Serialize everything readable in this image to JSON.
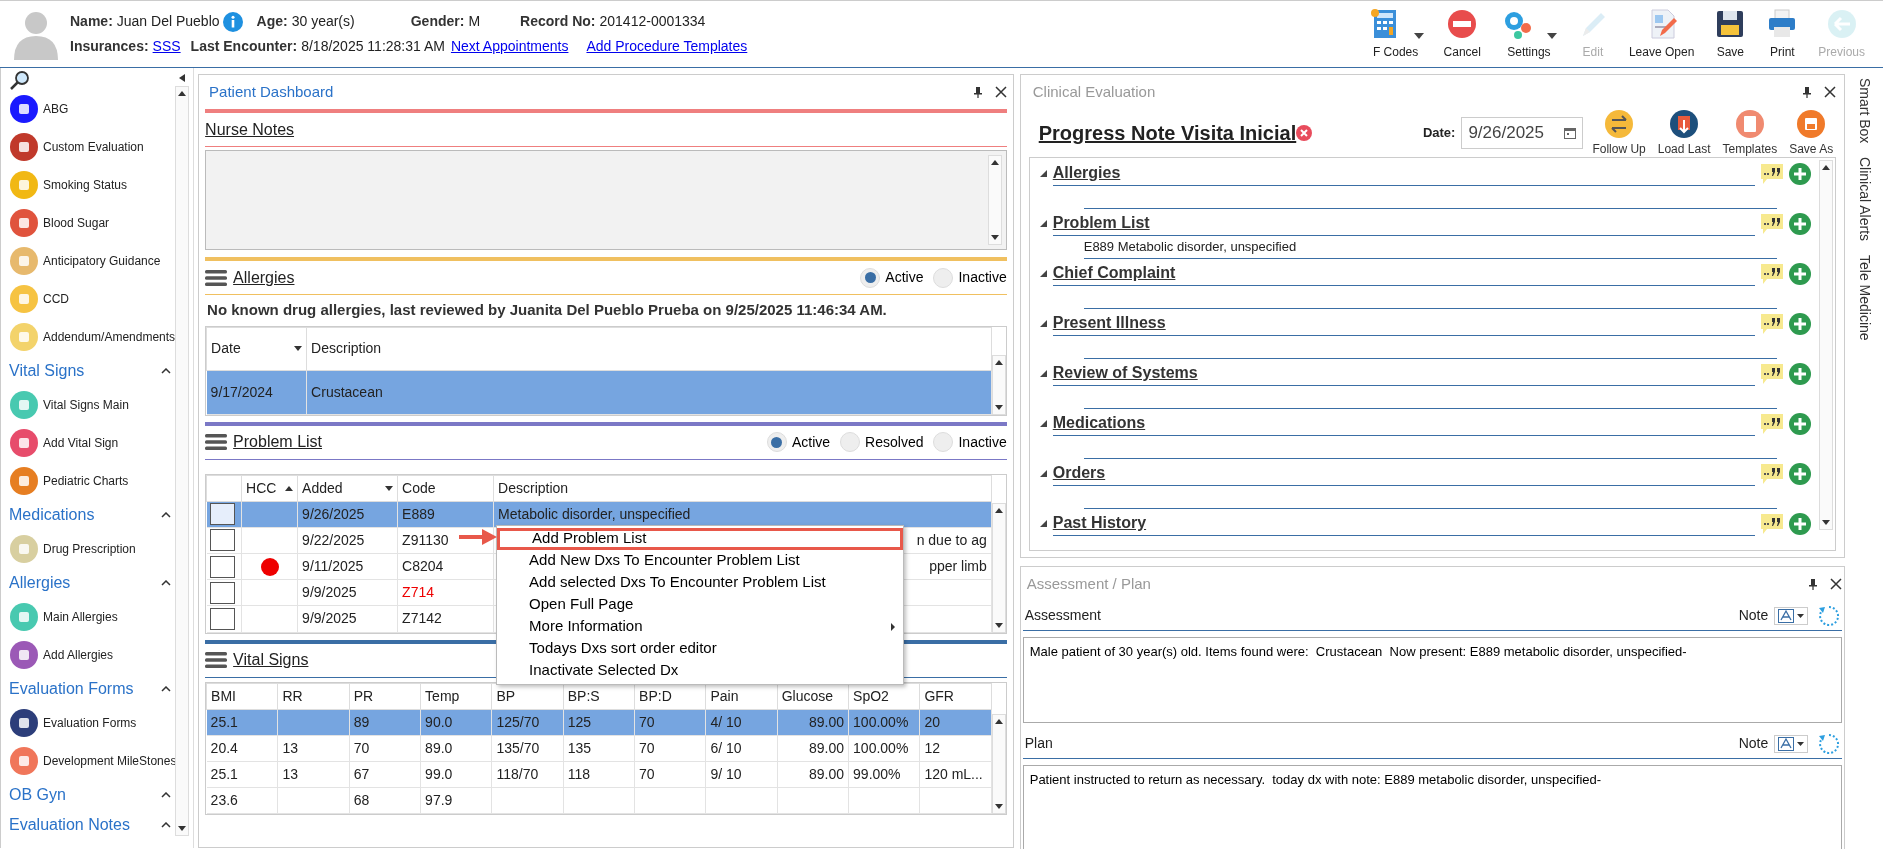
{
  "header": {
    "name_label": "Name:",
    "name": "Juan Del Pueblo",
    "age_label": "Age:",
    "age": "30 year(s)",
    "gender_label": "Gender:",
    "gender": "M",
    "record_label": "Record No:",
    "record": "201412-0001334",
    "insurances_label": "Insurances:",
    "insurance": "SSS",
    "last_encounter_label": "Last Encounter:",
    "last_encounter": "8/18/2025 11:28:31 AM",
    "links": [
      "Next Appointments",
      "Add Procedure Templates"
    ]
  },
  "toolbar": [
    {
      "label": "F Codes",
      "dropdown": true,
      "disabled": false
    },
    {
      "label": "Cancel",
      "dropdown": false,
      "disabled": false
    },
    {
      "label": "Settings",
      "dropdown": true,
      "disabled": false
    },
    {
      "label": "Edit",
      "dropdown": false,
      "disabled": true
    },
    {
      "label": "Leave Open",
      "dropdown": false,
      "disabled": false
    },
    {
      "label": "Save",
      "dropdown": false,
      "disabled": false
    },
    {
      "label": "Print",
      "dropdown": false,
      "disabled": false
    },
    {
      "label": "Previous",
      "dropdown": false,
      "disabled": true
    }
  ],
  "sidebar": {
    "items": [
      "ABG",
      "Custom Evaluation",
      "Smoking Status",
      "Blood Sugar",
      "Anticipatory Guidance",
      "CCD",
      "Addendum/Amendments"
    ],
    "sections": [
      {
        "title": "Vital Signs",
        "expanded": true,
        "items": [
          "Vital Signs Main",
          "Add Vital Sign",
          "Pediatric Charts"
        ]
      },
      {
        "title": "Medications",
        "expanded": true,
        "items": [
          "Drug Prescription"
        ]
      },
      {
        "title": "Allergies",
        "expanded": true,
        "items": [
          "Main Allergies",
          "Add Allergies"
        ]
      },
      {
        "title": "Evaluation Forms",
        "expanded": true,
        "items": [
          "Evaluation Forms",
          "Development MileStones"
        ]
      },
      {
        "title": "OB Gyn",
        "expanded": true
      },
      {
        "title": "Evaluation Notes",
        "expanded": true
      }
    ]
  },
  "dashboard": {
    "title": "Patient Dashboard",
    "nurse_notes": {
      "title": "Nurse Notes"
    },
    "allergies": {
      "title": "Allergies",
      "filters": [
        {
          "label": "Active",
          "selected": true
        },
        {
          "label": "Inactive",
          "selected": false
        }
      ],
      "note": "No known drug allergies, last reviewed by Juanita Del Pueblo Prueba on 9/25/2025 11:46:34 AM.",
      "columns": [
        {
          "label": "Date",
          "filterable": true
        },
        {
          "label": "Description"
        }
      ],
      "rows": [
        {
          "date": "9/17/2024",
          "description": "Crustacean",
          "selected": true
        }
      ]
    },
    "problem_list": {
      "title": "Problem List",
      "filters": [
        {
          "label": "Active",
          "selected": true
        },
        {
          "label": "Resolved",
          "selected": false
        },
        {
          "label": "Inactive",
          "selected": false
        }
      ],
      "columns": [
        {
          "label": "HCC",
          "sorted": true
        },
        {
          "label": "Added",
          "filterable": true
        },
        {
          "label": "Code"
        },
        {
          "label": "Description"
        }
      ],
      "rows": [
        {
          "checked": false,
          "selected": true,
          "hcc": false,
          "added": "9/26/2025",
          "code": "E889",
          "code_flagged": false,
          "description": "Metabolic disorder, unspecified"
        },
        {
          "checked": false,
          "selected": false,
          "hcc": false,
          "added": "9/22/2025",
          "code": "Z91130",
          "code_flagged": false,
          "description": "n due to ag"
        },
        {
          "checked": false,
          "selected": false,
          "hcc": true,
          "added": "9/11/2025",
          "code": "C8204",
          "code_flagged": false,
          "description": "pper limb"
        },
        {
          "checked": false,
          "selected": false,
          "hcc": false,
          "added": "9/9/2025",
          "code": "Z714",
          "code_flagged": true
        },
        {
          "checked": false,
          "selected": false,
          "hcc": false,
          "added": "9/9/2025",
          "code": "Z7142",
          "code_flagged": false
        }
      ]
    },
    "context_menu": [
      {
        "label": "Add Problem List",
        "highlighted": true,
        "submenu": false
      },
      {
        "label": "Add New Dxs To Encounter Problem List",
        "highlighted": false,
        "submenu": false
      },
      {
        "label": "Add selected Dxs To Encounter Problem List",
        "highlighted": false,
        "submenu": false
      },
      {
        "label": "Open Full Page",
        "highlighted": false,
        "submenu": false
      },
      {
        "label": "More Information",
        "highlighted": false,
        "submenu": true
      },
      {
        "label": "Todays Dxs sort order editor",
        "highlighted": false,
        "submenu": false
      },
      {
        "label": "Inactivate Selected Dx",
        "highlighted": false,
        "submenu": false
      }
    ],
    "vital_signs": {
      "title": "Vital Signs",
      "columns": [
        "BMI",
        "RR",
        "PR",
        "Temp",
        "BP",
        "BP:S",
        "BP:D",
        "Pain",
        "Glucose",
        "SpO2",
        "GFR"
      ],
      "rows": [
        {
          "selected": true,
          "cells": [
            "25.1",
            "",
            "89",
            "90.0",
            "125/70",
            "125",
            "70",
            "4/ 10",
            "89.00",
            "100.00%",
            "20"
          ]
        },
        {
          "selected": false,
          "cells": [
            "20.4",
            "13",
            "70",
            "89.0",
            "135/70",
            "135",
            "70",
            "6/ 10",
            "89.00",
            "100.00%",
            "12"
          ]
        },
        {
          "selected": false,
          "cells": [
            "25.1",
            "13",
            "67",
            "99.0",
            "118/70",
            "118",
            "70",
            "9/ 10",
            "89.00",
            "99.00%",
            "120 mL..."
          ]
        },
        {
          "selected": false,
          "cells": [
            "23.6",
            "",
            "68",
            "97.9",
            "",
            "",
            "",
            "",
            "",
            "",
            ""
          ]
        }
      ]
    }
  },
  "clinical_evaluation": {
    "title": "Clinical Evaluation",
    "note_title": "Progress Note Visita Inicial",
    "date_label": "Date:",
    "date": "9/26/2025",
    "actions": [
      "Follow Up",
      "Load Last",
      "Templates",
      "Save As"
    ],
    "sections": [
      {
        "title": "Allergies",
        "expanded": true
      },
      {
        "title": "Problem List",
        "expanded": true,
        "entries": [
          "E889 Metabolic disorder, unspecified"
        ]
      },
      {
        "title": "Chief Complaint",
        "expanded": true
      },
      {
        "title": "Present Illness",
        "expanded": true
      },
      {
        "title": "Review of Systems",
        "expanded": true
      },
      {
        "title": "Medications",
        "expanded": true
      },
      {
        "title": "Orders",
        "expanded": true
      },
      {
        "title": "Past History",
        "expanded": true
      }
    ]
  },
  "assessment_plan": {
    "title": "Assessment / Plan",
    "fields": [
      {
        "label": "Assessment",
        "note_label": "Note",
        "text": "Male patient of 30 year(s) old. Items found were:  Crustacean  Now present: E889 metabolic disorder, unspecified-"
      },
      {
        "label": "Plan",
        "note_label": "Note",
        "text": "Patient instructed to return as necessary.  today dx with note: E889 metabolic disorder, unspecified-"
      }
    ]
  },
  "side_tabs": [
    "Smart Box",
    "Clinical Alerts",
    "Tele Medicine"
  ]
}
